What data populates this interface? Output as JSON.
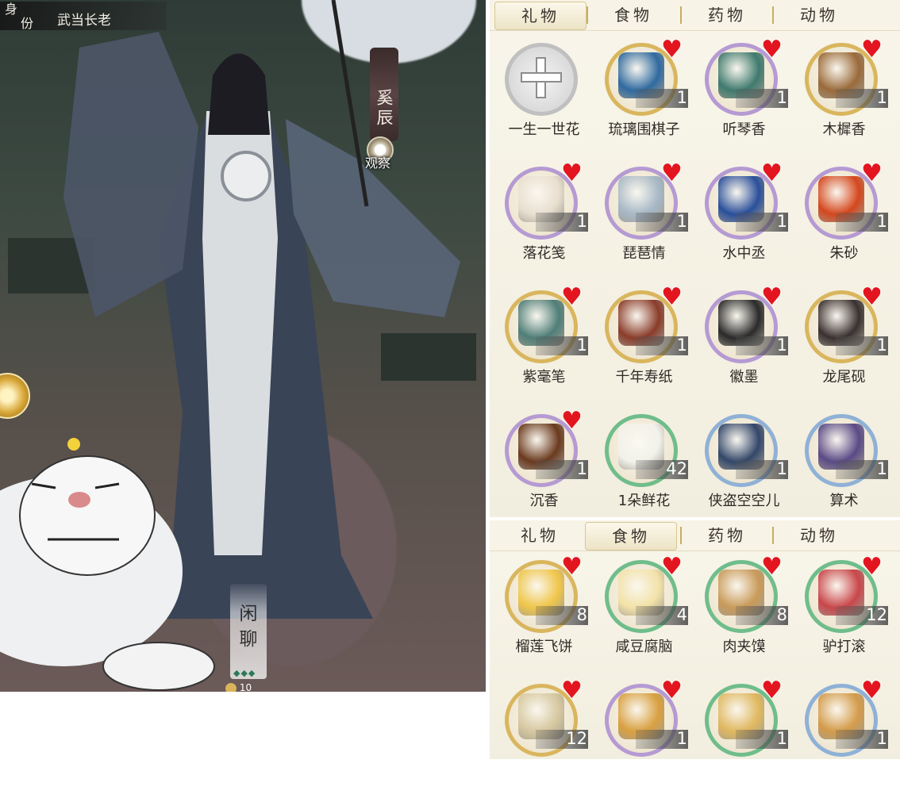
{
  "character": {
    "identity_label": [
      "身",
      "份"
    ],
    "identity_title": "武当长老",
    "name": "奚辰",
    "observe_label": "观察",
    "chat_label": [
      "闲",
      "聊"
    ],
    "chat_dots": "◆◆◆",
    "bottom_counter": "10"
  },
  "gift_panel": {
    "tabs": [
      {
        "label": "礼物",
        "active": true
      },
      {
        "label": "食物",
        "active": false
      },
      {
        "label": "药物",
        "active": false
      },
      {
        "label": "动物",
        "active": false
      }
    ],
    "items": [
      {
        "name": "一生一世花",
        "count": "",
        "heart": false,
        "ring": "grey",
        "icon": "add-icon"
      },
      {
        "name": "琉璃围棋子",
        "count": "1",
        "heart": true,
        "ring": "gold",
        "icon": "go-stones-icon",
        "color": "#2f6aa0"
      },
      {
        "name": "听琴香",
        "count": "1",
        "heart": true,
        "ring": "purple",
        "icon": "incense-burner-icon",
        "color": "#3f7a6e"
      },
      {
        "name": "木樨香",
        "count": "1",
        "heart": true,
        "ring": "gold",
        "icon": "incense-sticks-icon",
        "color": "#9a6a3a"
      },
      {
        "name": "落花笺",
        "count": "1",
        "heart": true,
        "ring": "purple",
        "icon": "letter-paper-icon",
        "color": "#e9dfd0"
      },
      {
        "name": "琵琶情",
        "count": "1",
        "heart": true,
        "ring": "purple",
        "icon": "pipa-icon",
        "color": "#a7b8c6"
      },
      {
        "name": "水中丞",
        "count": "1",
        "heart": true,
        "ring": "purple",
        "icon": "water-pot-icon",
        "color": "#2a4f9a"
      },
      {
        "name": "朱砂",
        "count": "1",
        "heart": true,
        "ring": "purple",
        "icon": "cinnabar-icon",
        "color": "#d4471d"
      },
      {
        "name": "紫毫笔",
        "count": "1",
        "heart": true,
        "ring": "gold",
        "icon": "brush-icon",
        "color": "#4f7e78"
      },
      {
        "name": "千年寿纸",
        "count": "1",
        "heart": true,
        "ring": "gold",
        "icon": "paper-roll-icon",
        "color": "#8a3c2a"
      },
      {
        "name": "徽墨",
        "count": "1",
        "heart": true,
        "ring": "purple",
        "icon": "ink-stick-icon",
        "color": "#2a2a2a"
      },
      {
        "name": "龙尾砚",
        "count": "1",
        "heart": true,
        "ring": "gold",
        "icon": "inkstone-icon",
        "color": "#3a3030"
      },
      {
        "name": "沉香",
        "count": "1",
        "heart": true,
        "ring": "purple",
        "icon": "agarwood-icon",
        "color": "#6a3a1e"
      },
      {
        "name": "1朵鲜花",
        "count": "42",
        "heart": false,
        "ring": "green",
        "icon": "flower-icon",
        "color": "#f2f2ea"
      },
      {
        "name": "侠盗空空儿",
        "count": "1",
        "heart": false,
        "ring": "blue",
        "icon": "book-icon",
        "color": "#33476a"
      },
      {
        "name": "算术",
        "count": "1",
        "heart": false,
        "ring": "blue",
        "icon": "book-icon",
        "color": "#5a4a86"
      }
    ]
  },
  "food_panel": {
    "tabs": [
      {
        "label": "礼物",
        "active": false
      },
      {
        "label": "食物",
        "active": true
      },
      {
        "label": "药物",
        "active": false
      },
      {
        "label": "动物",
        "active": false
      }
    ],
    "items": [
      {
        "name": "榴莲飞饼",
        "count": "8",
        "heart": true,
        "ring": "gold",
        "icon": "pancake-icon",
        "color": "#f0c64a"
      },
      {
        "name": "咸豆腐脑",
        "count": "4",
        "heart": true,
        "ring": "green",
        "icon": "tofu-bowl-icon",
        "color": "#f3e2a8"
      },
      {
        "name": "肉夹馍",
        "count": "8",
        "heart": true,
        "ring": "green",
        "icon": "meat-bun-icon",
        "color": "#c99a5a"
      },
      {
        "name": "驴打滚",
        "count": "12",
        "heart": true,
        "ring": "green",
        "icon": "rice-roll-icon",
        "color": "#c9464a"
      },
      {
        "name": "",
        "count": "12",
        "heart": true,
        "ring": "gold",
        "icon": "steamer-icon",
        "color": "#d6c8a0"
      },
      {
        "name": "",
        "count": "1",
        "heart": true,
        "ring": "purple",
        "icon": "fried-cake-icon",
        "color": "#d9a040"
      },
      {
        "name": "",
        "count": "1",
        "heart": true,
        "ring": "green",
        "icon": "spring-roll-icon",
        "color": "#e0b860"
      },
      {
        "name": "",
        "count": "1",
        "heart": true,
        "ring": "blue",
        "icon": "cookie-icon",
        "color": "#d49b4a"
      }
    ]
  }
}
